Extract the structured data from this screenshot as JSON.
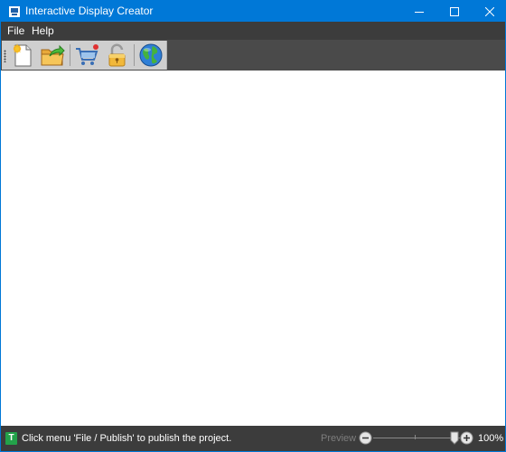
{
  "window": {
    "title": "Interactive Display Creator",
    "icons": {
      "app": "app-icon",
      "minimize": "minimize-icon",
      "maximize": "maximize-icon",
      "close": "close-icon"
    }
  },
  "menu": {
    "items": [
      {
        "label": "File"
      },
      {
        "label": "Help"
      }
    ]
  },
  "toolbar": {
    "buttons": [
      {
        "icon": "new-project-icon"
      },
      {
        "icon": "open-folder-icon"
      },
      {
        "icon": "shopping-cart-icon"
      },
      {
        "icon": "padlock-icon"
      },
      {
        "icon": "globe-icon"
      }
    ]
  },
  "status": {
    "message": "Click menu 'File / Publish' to publish the project.",
    "preview_label": "Preview",
    "zoom_level": "100%",
    "zoom_percent": 100
  },
  "colors": {
    "title_bar": "#0078d7",
    "dark_bars": "#3c3c3c",
    "toolbar": "#cfcfcf",
    "status_icon": "#23a24a"
  }
}
